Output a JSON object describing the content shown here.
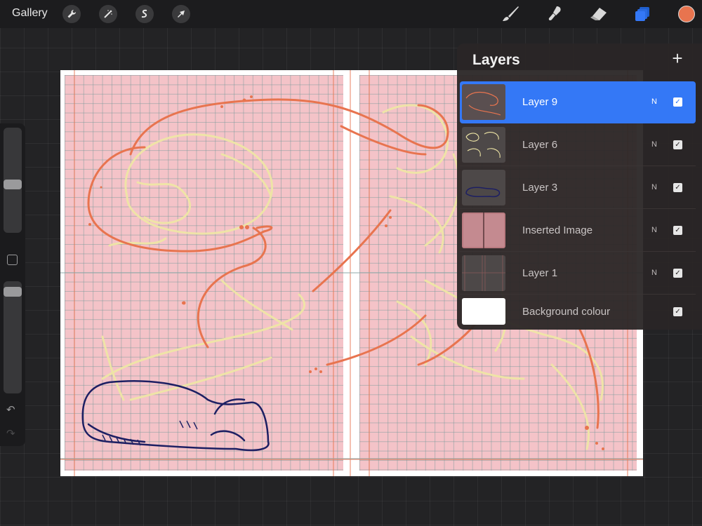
{
  "topbar": {
    "gallery_label": "Gallery",
    "left_tools": [
      "wrench-icon",
      "magic-wand-icon",
      "selection-s-icon",
      "transform-arrow-icon"
    ],
    "right_tools": [
      "brush-icon",
      "smudge-icon",
      "eraser-icon",
      "layers-icon"
    ],
    "active_tool": "layers-icon",
    "current_color": "#e8744f"
  },
  "sidebar": {
    "controls": [
      "brush-size-slider",
      "modify-button",
      "opacity-slider",
      "undo-icon",
      "redo-icon"
    ]
  },
  "layers": {
    "title": "Layers",
    "add_icon": "plus-icon",
    "items": [
      {
        "name": "Layer 9",
        "blend": "N",
        "visible": true,
        "active": true
      },
      {
        "name": "Layer 6",
        "blend": "N",
        "visible": true,
        "active": false
      },
      {
        "name": "Layer 3",
        "blend": "N",
        "visible": true,
        "active": false
      },
      {
        "name": "Inserted Image",
        "blend": "N",
        "visible": true,
        "active": false
      },
      {
        "name": "Layer 1",
        "blend": "N",
        "visible": true,
        "active": false
      },
      {
        "name": "Background colour",
        "blend": "",
        "visible": true,
        "active": false
      }
    ]
  },
  "colors": {
    "accent": "#3478f6",
    "sketch_orange": "#e8744f",
    "sketch_yellow": "#efe6a6",
    "ink_navy": "#1d1f63",
    "page_pink": "#f4c3c8"
  }
}
